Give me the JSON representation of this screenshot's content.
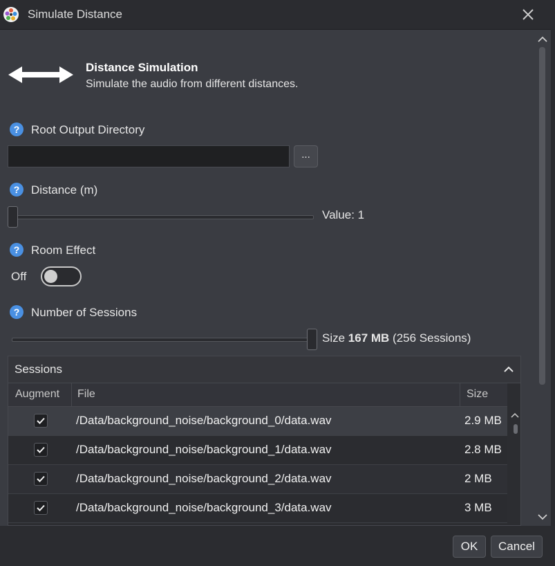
{
  "window": {
    "title": "Simulate Distance"
  },
  "header": {
    "title": "Distance Simulation",
    "subtitle": "Simulate the audio from different distances."
  },
  "root_output": {
    "label": "Root Output Directory",
    "value": "",
    "browse_label": "..."
  },
  "distance": {
    "label": "Distance (m)",
    "value_text": "Value:  1",
    "value": 1
  },
  "room_effect": {
    "label": "Room Effect",
    "state_label": "Off",
    "enabled": false
  },
  "sessions_count": {
    "label": "Number of Sessions",
    "size_prefix": "Size ",
    "size_value": "167 MB",
    "size_suffix": " (256 Sessions)",
    "level": 1.0
  },
  "sessions": {
    "title": "Sessions",
    "columns": {
      "augment": "Augment",
      "file": "File",
      "size": "Size"
    },
    "rows": [
      {
        "checked": true,
        "file": "/Data/background_noise/background_0/data.wav",
        "size": "2.9 MB"
      },
      {
        "checked": true,
        "file": "/Data/background_noise/background_1/data.wav",
        "size": "2.8 MB"
      },
      {
        "checked": true,
        "file": "/Data/background_noise/background_2/data.wav",
        "size": "2 MB"
      },
      {
        "checked": true,
        "file": "/Data/background_noise/background_3/data.wav",
        "size": "3 MB"
      }
    ]
  },
  "footer": {
    "ok_label": "OK",
    "cancel_label": "Cancel"
  },
  "colors": {
    "background": "#3a3c42",
    "accent": "#4a90e2",
    "panel": "#2c2d31"
  },
  "icons": {
    "app": "app-logo-icon",
    "close": "close-icon",
    "header": "double-arrow-icon",
    "help": "help-icon",
    "collapse": "chevron-up-icon",
    "checkbox": "checkmark-icon"
  }
}
